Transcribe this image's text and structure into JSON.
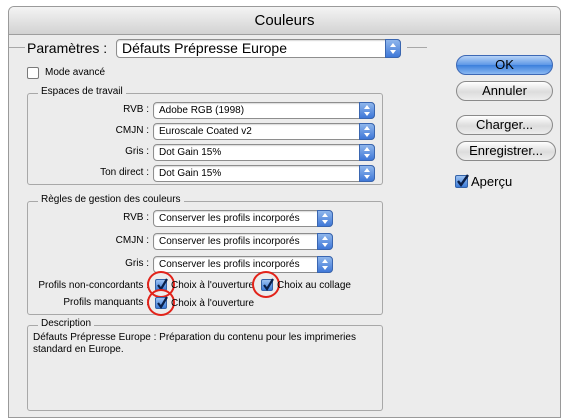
{
  "window": {
    "title": "Couleurs"
  },
  "settings": {
    "label": "Paramètres :",
    "value": "Défauts Prépresse Europe"
  },
  "advanced_mode": {
    "label": "Mode avancé",
    "checked": false
  },
  "workspaces": {
    "title": "Espaces de travail",
    "rows": [
      {
        "label": "RVB :",
        "value": "Adobe RGB (1998)"
      },
      {
        "label": "CMJN :",
        "value": "Euroscale Coated v2"
      },
      {
        "label": "Gris :",
        "value": "Dot Gain 15%"
      },
      {
        "label": "Ton direct :",
        "value": "Dot Gain 15%"
      }
    ]
  },
  "policies": {
    "title": "Règles de gestion des couleurs",
    "rows": [
      {
        "label": "RVB :",
        "value": "Conserver les profils incorporés"
      },
      {
        "label": "CMJN :",
        "value": "Conserver les profils incorporés"
      },
      {
        "label": "Gris :",
        "value": "Conserver les profils incorporés"
      }
    ],
    "mismatch": {
      "label": "Profils non-concordants :",
      "open_label": "Choix à l'ouverture",
      "open_checked": true,
      "paste_label": "Choix au collage",
      "paste_checked": true
    },
    "missing": {
      "label": "Profils manquants :",
      "open_label": "Choix à l'ouverture",
      "open_checked": true
    }
  },
  "description": {
    "title": "Description",
    "text": "Défauts Prépresse Europe : Préparation du contenu pour les imprimeries standard en Europe."
  },
  "buttons": {
    "ok": "OK",
    "cancel": "Annuler",
    "load": "Charger...",
    "save": "Enregistrer..."
  },
  "preview": {
    "label": "Aperçu",
    "checked": true
  },
  "colors": {
    "accent": "#3c7bd8",
    "highlight_ring": "#e2231a"
  }
}
